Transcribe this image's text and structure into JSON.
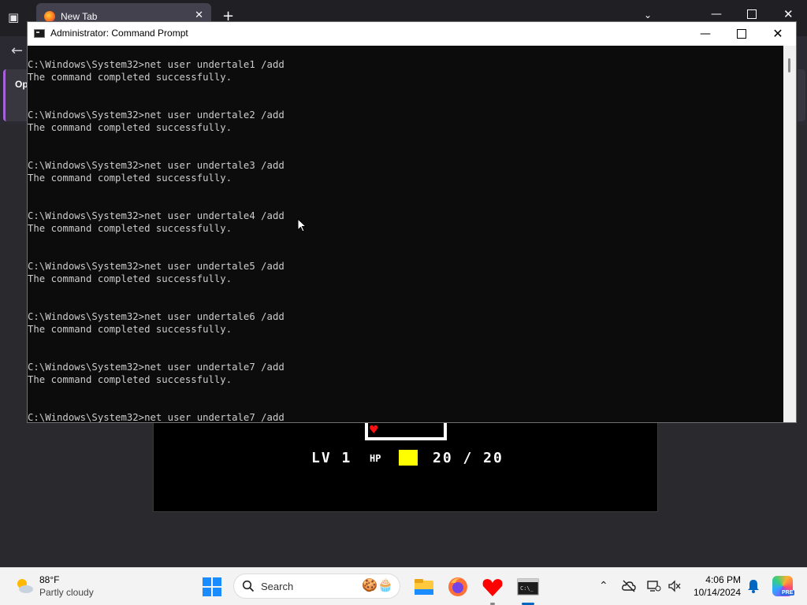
{
  "browser": {
    "tab_title": "New Tab",
    "page_card_label": "Op"
  },
  "cmd": {
    "title": "Administrator: Command Prompt",
    "blocks": [
      {
        "prompt": "C:\\Windows\\System32>net user undertale1 /add",
        "output": "The command completed successfully."
      },
      {
        "prompt": "C:\\Windows\\System32>net user undertale2 /add",
        "output": "The command completed successfully."
      },
      {
        "prompt": "C:\\Windows\\System32>net user undertale3 /add",
        "output": "The command completed successfully."
      },
      {
        "prompt": "C:\\Windows\\System32>net user undertale4 /add",
        "output": "The command completed successfully."
      },
      {
        "prompt": "C:\\Windows\\System32>net user undertale5 /add",
        "output": "The command completed successfully."
      },
      {
        "prompt": "C:\\Windows\\System32>net user undertale6 /add",
        "output": "The command completed successfully."
      },
      {
        "prompt": "C:\\Windows\\System32>net user undertale7 /add",
        "output": "The command completed successfully."
      }
    ],
    "current_line": "C:\\Windows\\System32>net user undertale7 /add"
  },
  "game": {
    "lv": "LV 1",
    "hp_label": "HP",
    "hp_text": "20 / 20",
    "hp_current": 20,
    "hp_max": 20,
    "hp_color": "#ffff00",
    "heart_color": "#ff1010"
  },
  "taskbar": {
    "weather_temp": "88°F",
    "weather_condition": "Partly cloudy",
    "search_label": "Search",
    "time": "4:06 PM",
    "date": "10/14/2024",
    "copilot_badge": "PRE",
    "pinned_icons": [
      "start-icon",
      "file-explorer-icon",
      "firefox-icon",
      "undertale-icon",
      "command-prompt-icon"
    ]
  }
}
